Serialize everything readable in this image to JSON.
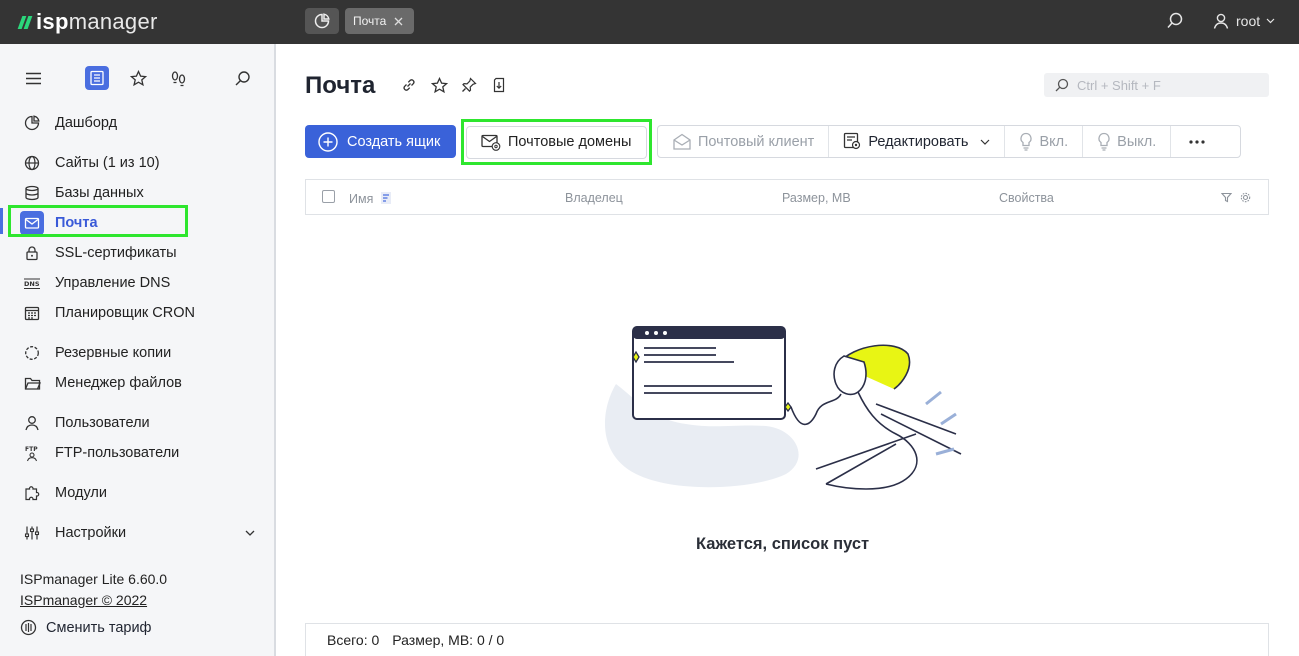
{
  "topbar": {
    "logo_prefix": "isp",
    "logo_suffix": "manager",
    "tab_label": "Почта",
    "user": "root"
  },
  "sidebar": {
    "items": [
      {
        "label": "Дашборд",
        "icon": "dashboard-icon"
      },
      {
        "label": "Сайты (1 из 10)",
        "icon": "globe-icon"
      },
      {
        "label": "Базы данных",
        "icon": "database-icon"
      },
      {
        "label": "Почта",
        "icon": "mail-icon"
      },
      {
        "label": "SSL-сертификаты",
        "icon": "lock-icon"
      },
      {
        "label": "Управление DNS",
        "icon": "dns-icon"
      },
      {
        "label": "Планировщик CRON",
        "icon": "calendar-icon"
      },
      {
        "label": "Резервные копии",
        "icon": "backup-icon"
      },
      {
        "label": "Менеджер файлов",
        "icon": "folder-icon"
      },
      {
        "label": "Пользователи",
        "icon": "user-icon"
      },
      {
        "label": "FTP-пользователи",
        "icon": "ftp-icon"
      },
      {
        "label": "Модули",
        "icon": "puzzle-icon"
      },
      {
        "label": "Настройки",
        "icon": "sliders-icon"
      }
    ],
    "version": "ISPmanager Lite 6.60.0",
    "copyright": "ISPmanager © 2022",
    "tariff": "Сменить тариф"
  },
  "main": {
    "title": "Почта",
    "search_placeholder": "Ctrl + Shift + F",
    "create_button": "Создать ящик",
    "domains_button": "Почтовые домены",
    "toolbar": {
      "client": "Почтовый клиент",
      "edit": "Редактировать",
      "on": "Вкл.",
      "off": "Выкл."
    },
    "columns": {
      "name": "Имя",
      "owner": "Владелец",
      "size": "Размер, MB",
      "props": "Свойства"
    },
    "empty_text": "Кажется, список пуст",
    "footer": {
      "total": "Всего: 0",
      "size": "Размер, MB: 0 / 0"
    }
  },
  "colors": {
    "accent": "#3a62d9",
    "highlight": "#2ee62e",
    "topbar": "#343434",
    "logo_green": "#2bd67b",
    "illustration_yellow": "#e8f514"
  }
}
